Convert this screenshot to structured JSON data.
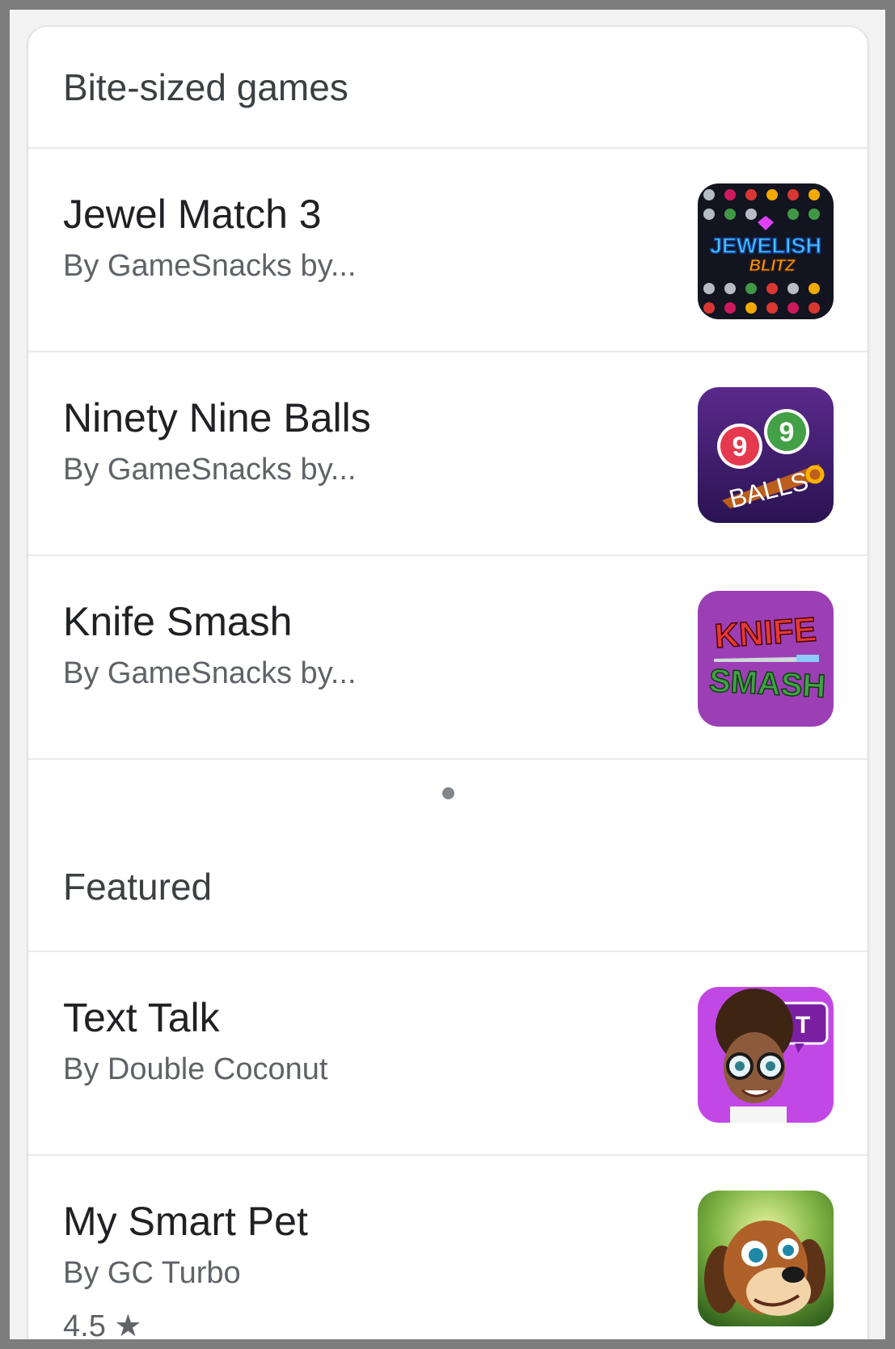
{
  "sections": [
    {
      "title": "Bite-sized games",
      "items": [
        {
          "title": "Jewel Match 3",
          "subtitle": "By GameSnacks by...",
          "icon": "jewelish-blitz-icon",
          "icon_text": [
            "JEWELISH",
            "BLITZ"
          ]
        },
        {
          "title": "Ninety Nine Balls",
          "subtitle": "By GameSnacks by...",
          "icon": "ninety-nine-balls-icon",
          "icon_text": [
            "9",
            "9",
            "BALLS"
          ]
        },
        {
          "title": "Knife Smash",
          "subtitle": "By GameSnacks by...",
          "icon": "knife-smash-icon",
          "icon_text": [
            "KNIFE",
            "SMASH"
          ]
        }
      ]
    },
    {
      "title": "Featured",
      "items": [
        {
          "title": "Text Talk",
          "subtitle": "By Double Coconut",
          "icon": "text-talk-icon",
          "icon_text": [
            "T"
          ]
        },
        {
          "title": "My Smart Pet",
          "subtitle": "By GC Turbo",
          "rating": "4.5 ★",
          "icon": "my-smart-pet-icon"
        }
      ]
    }
  ],
  "colors": {
    "accent_purple": "#5b2d8f",
    "knife_red": "#e53935",
    "knife_green": "#2e7d32",
    "text_primary": "#202124",
    "text_secondary": "#5f6368"
  }
}
